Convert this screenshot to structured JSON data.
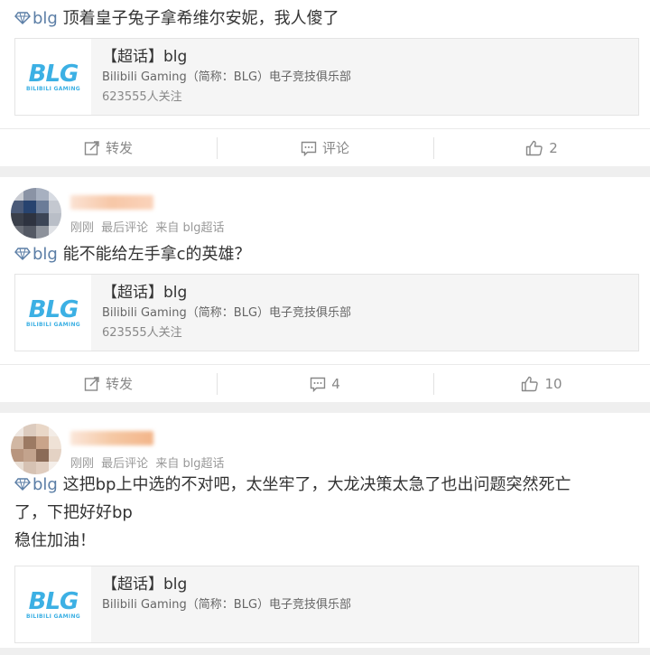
{
  "topic_name": "blg",
  "card": {
    "title": "【超话】blg",
    "logo_text": "BLG",
    "logo_sub": "BILIBILI GAMING",
    "description": "Bilibili Gaming（简称：BLG）电子竞技俱乐部",
    "followers": "623555人关注"
  },
  "action_labels": {
    "repost": "转发",
    "comment": "评论"
  },
  "posts": [
    {
      "text": "顶着皇子兔子拿希维尔安妮，我人傻了",
      "actions": {
        "repost": "转发",
        "comment": "评论",
        "likes": "2"
      }
    },
    {
      "meta": {
        "time": "刚刚",
        "last_comment": "最后评论",
        "source": "来自 blg超话"
      },
      "text": "能不能给左手拿c的英雄？",
      "actions": {
        "repost": "转发",
        "comment": "4",
        "likes": "10"
      }
    },
    {
      "meta": {
        "time": "刚刚",
        "last_comment": "最后评论",
        "source": "来自 blg超话"
      },
      "text_lines": [
        "这把bp上中选的不对吧，太坐牢了，大龙决策太急了也出问题突然死亡",
        "了，下把好好bp",
        "稳住加油！"
      ]
    }
  ],
  "colors": {
    "link": "#5b7ea6",
    "logo": "#3cb0e4",
    "meta": "#999999",
    "background": "#efefef"
  }
}
